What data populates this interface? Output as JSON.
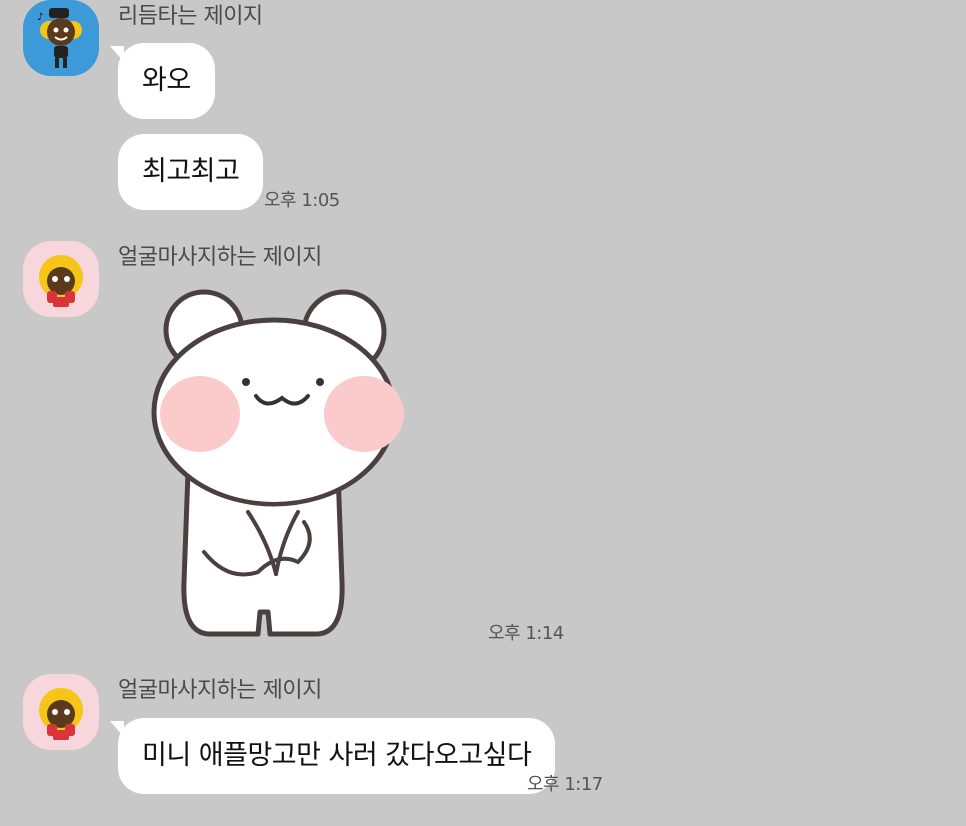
{
  "messages": [
    {
      "sender": "리듬타는 제이지",
      "texts": [
        "와오",
        "최고최고"
      ],
      "time": "오후 1:05"
    },
    {
      "sender": "얼굴마사지하는 제이지",
      "sticker": "bear-sticker",
      "time": "오후 1:14"
    },
    {
      "sender": "얼굴마사지하는 제이지",
      "texts": [
        "미니 애플망고만 사러 갔다오고싶다"
      ],
      "time": "오후 1:17"
    }
  ],
  "colors": {
    "background": "#c8c8c8",
    "bubble": "#ffffff",
    "avatar_blue": "#3d9ad8",
    "avatar_pink": "#f7d6dc",
    "avatar_yellow": "#f5c518"
  }
}
